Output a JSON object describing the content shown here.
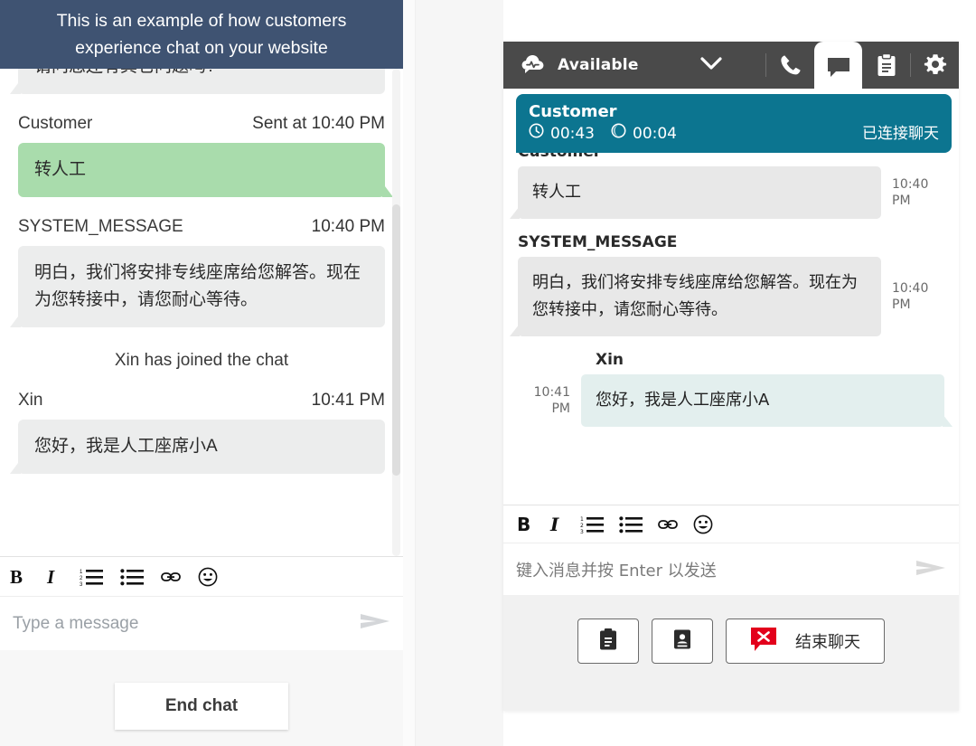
{
  "left_widget": {
    "banner": "This is an example of how customers experience chat on your website",
    "messages": [
      {
        "kind": "bubble-partial",
        "side": "in",
        "text": "请问您还有其它问题吗?"
      },
      {
        "kind": "meta",
        "who": "Customer",
        "when": "Sent at  10:40 PM"
      },
      {
        "kind": "bubble",
        "side": "out",
        "text": "转人工"
      },
      {
        "kind": "meta",
        "who": "SYSTEM_MESSAGE",
        "when": "10:40 PM"
      },
      {
        "kind": "bubble",
        "side": "in",
        "text": "明白，我们将安排专线座席给您解答。现在为您转接中，请您耐心等待。"
      },
      {
        "kind": "system",
        "text": "Xin has joined the chat"
      },
      {
        "kind": "meta",
        "who": "Xin",
        "when": "10:41 PM"
      },
      {
        "kind": "bubble",
        "side": "in",
        "text": "您好，我是人工座席小A"
      }
    ],
    "toolbar": [
      {
        "icon": "bold-icon",
        "glyph": "B"
      },
      {
        "icon": "italic-icon",
        "glyph": "I"
      },
      {
        "icon": "ordered-list-icon",
        "glyph": "ol"
      },
      {
        "icon": "bulleted-list-icon",
        "glyph": "ul"
      },
      {
        "icon": "link-icon",
        "glyph": "link"
      },
      {
        "icon": "emoji-icon",
        "glyph": "emoji"
      }
    ],
    "composer": {
      "placeholder": "Type a message",
      "send_icon": "send-icon"
    },
    "end_chat_label": "End chat"
  },
  "right_widget": {
    "topbar": {
      "brand_icon": "cloud-pulse-icon",
      "status_label": "Available",
      "status_caret": "chevron-down-icon",
      "tabs": [
        {
          "icon": "phone-icon",
          "active": false
        },
        {
          "icon": "chat-bubble-icon",
          "active": true
        },
        {
          "icon": "clipboard-icon",
          "active": false
        },
        {
          "icon": "gear-icon",
          "active": false
        }
      ]
    },
    "customer_bar": {
      "name": "Customer",
      "clock_icon": "clock-icon",
      "clock_value": "00:43",
      "moon_icon": "moon-icon",
      "moon_value": "00:04",
      "connection_status": "已连接聊天"
    },
    "messages": [
      {
        "who": "Customer",
        "side": "in",
        "text": "转人工",
        "time": "10:40 PM"
      },
      {
        "who": "SYSTEM_MESSAGE",
        "side": "in",
        "text": "明白，我们将安排专线座席给您解答。现在为您转接中，请您耐心等待。",
        "time": "10:40 PM"
      },
      {
        "who": "Xin",
        "side": "out",
        "text": "您好，我是人工座席小A",
        "time": "10:41 PM"
      }
    ],
    "toolbar": [
      {
        "icon": "bold-icon",
        "glyph": "B"
      },
      {
        "icon": "italic-icon",
        "glyph": "I"
      },
      {
        "icon": "ordered-list-icon",
        "glyph": "ol"
      },
      {
        "icon": "bulleted-list-icon",
        "glyph": "ul"
      },
      {
        "icon": "link-icon",
        "glyph": "link"
      },
      {
        "icon": "emoji-icon",
        "glyph": "emoji"
      }
    ],
    "composer": {
      "placeholder": "键入消息并按 Enter 以发送",
      "send_icon": "send-icon"
    },
    "actions": {
      "clipboard_icon": "clipboard-icon",
      "contact_card_icon": "contact-card-icon",
      "end_chat_icon": "end-chat-red-icon",
      "end_chat_label": "结束聊天"
    }
  },
  "colors": {
    "banner": "#3f5372",
    "customer_bubble": "#a9dcac",
    "agent_bubble": "#eceded",
    "teal": "#0c7590",
    "topbar": "#4a4a4a",
    "agent_cyan_bubble": "#e3efee",
    "end_chat_red": "#e3001b"
  }
}
